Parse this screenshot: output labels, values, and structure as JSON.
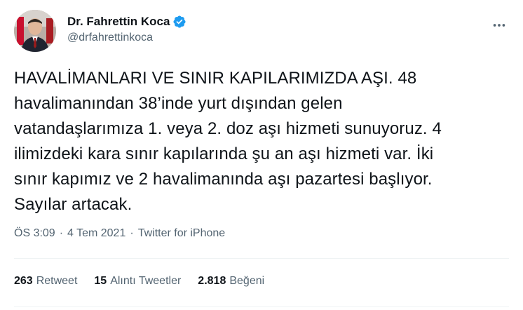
{
  "author": {
    "display_name": "Dr. Fahrettin Koca",
    "handle": "@drfahrettinkoca",
    "verified": true
  },
  "tweet": {
    "text": "HAVALİMANLARI VE SINIR KAPILARIMIZDA AŞI. 48\nhavalimanından 38’inde yurt dışından gelen\nvatandaşlarımıza 1. veya 2. doz aşı hizmeti sunuyoruz. 4\nilimizdeki kara sınır kapılarında şu an aşı hizmeti var. İki\nsınır kapımız ve 2 havalimanında aşı pazartesi başlıyor.\nSayılar artacak."
  },
  "meta": {
    "time": "ÖS 3:09",
    "separator": "·",
    "date": "4 Tem 2021",
    "source": "Twitter for iPhone"
  },
  "stats": {
    "retweets_count": "263",
    "retweets_label": "Retweet",
    "quotes_count": "15",
    "quotes_label": "Alıntı Tweetler",
    "likes_count": "2.818",
    "likes_label": "Beğeni"
  },
  "colors": {
    "verified_badge": "#1d9bf0",
    "text_primary": "#0f1419",
    "text_secondary": "#536471",
    "divider": "#eff3f4"
  },
  "icons": {
    "verified": "verified-badge-icon",
    "more": "more-horizontal-icon"
  }
}
